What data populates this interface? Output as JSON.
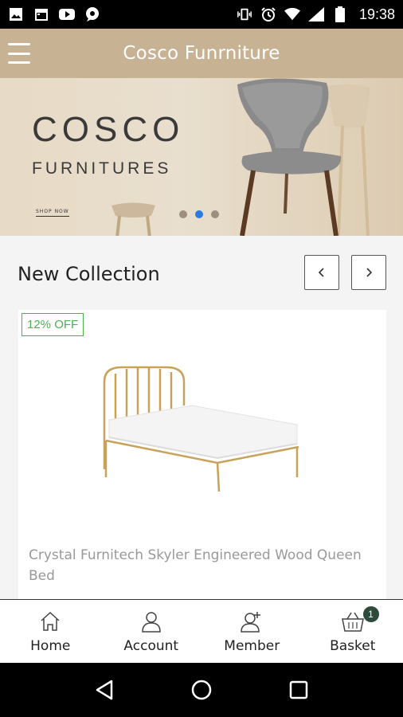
{
  "status_bar": {
    "time": "19:38",
    "icons": [
      "image-icon",
      "calendar-icon",
      "youtube-icon",
      "notification-icon",
      "vibrate-icon",
      "alarm-icon",
      "wifi-icon",
      "signal-icon",
      "battery-icon"
    ]
  },
  "app_bar": {
    "title": "Cosco Funrniture",
    "menu_icon": "menu-icon"
  },
  "banner": {
    "title": "COSCO",
    "subtitle": "FURNITURES",
    "cta": "SHOP NOW",
    "active_slide": 2,
    "slide_count": 3
  },
  "section": {
    "title": "New Collection",
    "prev_icon": "chevron-left-icon",
    "next_icon": "chevron-right-icon"
  },
  "product": {
    "discount": "12% OFF",
    "name": "Crystal Furnitech Skyler Engineered Wood Queen Bed"
  },
  "bottom_nav": {
    "items": [
      {
        "label": "Home",
        "icon": "home-icon"
      },
      {
        "label": "Account",
        "icon": "account-icon"
      },
      {
        "label": "Member",
        "icon": "add-member-icon"
      },
      {
        "label": "Basket",
        "icon": "basket-icon",
        "badge": "1"
      }
    ]
  },
  "colors": {
    "app_bar": "#c8b294",
    "active_dot": "#2b7be2",
    "discount": "#4caf50"
  }
}
